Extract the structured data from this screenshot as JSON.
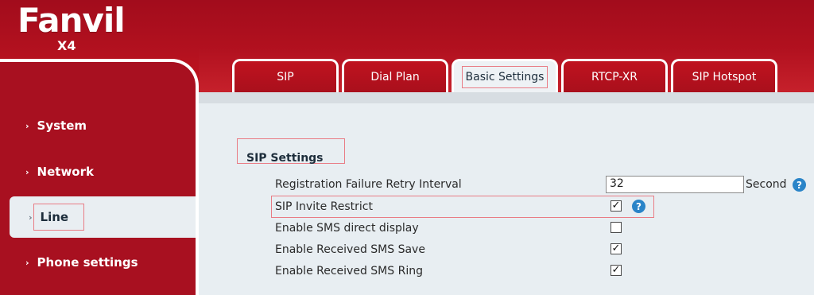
{
  "brand": {
    "name": "Fanvil",
    "model": "X4"
  },
  "sidebar": {
    "items": [
      {
        "label": "System",
        "active": false
      },
      {
        "label": "Network",
        "active": false
      },
      {
        "label": "Line",
        "active": true
      },
      {
        "label": "Phone settings",
        "active": false
      }
    ]
  },
  "tabs": [
    {
      "label": "SIP",
      "active": false
    },
    {
      "label": "Dial Plan",
      "active": false
    },
    {
      "label": "Basic Settings",
      "active": true
    },
    {
      "label": "RTCP-XR",
      "active": false
    },
    {
      "label": "SIP Hotspot",
      "active": false
    }
  ],
  "section": {
    "title": "SIP Settings"
  },
  "settings": {
    "retry_interval": {
      "label": "Registration Failure Retry Interval",
      "value": "32",
      "unit": "Second"
    },
    "invite_restrict": {
      "label": "SIP Invite Restrict",
      "checked": true
    },
    "sms_direct": {
      "label": "Enable SMS direct display",
      "checked": false
    },
    "sms_save": {
      "label": "Enable Received SMS Save",
      "checked": true
    },
    "sms_ring": {
      "label": "Enable Received SMS Ring",
      "checked": true
    }
  },
  "glyphs": {
    "check": "✓",
    "help": "?",
    "arrow": "›"
  },
  "colors": {
    "brand_red": "#a50d1e",
    "content_bg": "#e8eef2",
    "help_blue": "#2a84c8",
    "highlight": "#e97c85"
  }
}
